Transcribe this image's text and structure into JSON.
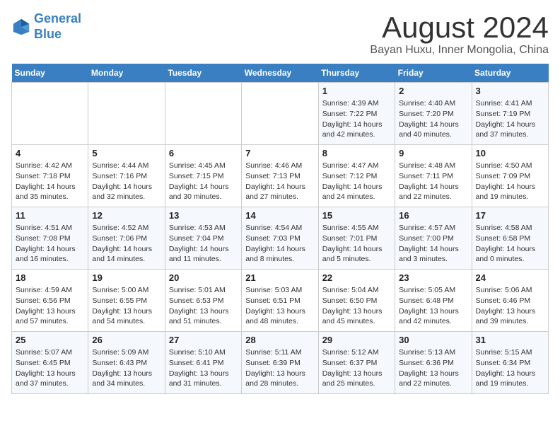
{
  "header": {
    "logo_line1": "General",
    "logo_line2": "Blue",
    "month_year": "August 2024",
    "location": "Bayan Huxu, Inner Mongolia, China"
  },
  "weekdays": [
    "Sunday",
    "Monday",
    "Tuesday",
    "Wednesday",
    "Thursday",
    "Friday",
    "Saturday"
  ],
  "weeks": [
    [
      {
        "day": "",
        "info": ""
      },
      {
        "day": "",
        "info": ""
      },
      {
        "day": "",
        "info": ""
      },
      {
        "day": "",
        "info": ""
      },
      {
        "day": "1",
        "info": "Sunrise: 4:39 AM\nSunset: 7:22 PM\nDaylight: 14 hours\nand 42 minutes."
      },
      {
        "day": "2",
        "info": "Sunrise: 4:40 AM\nSunset: 7:20 PM\nDaylight: 14 hours\nand 40 minutes."
      },
      {
        "day": "3",
        "info": "Sunrise: 4:41 AM\nSunset: 7:19 PM\nDaylight: 14 hours\nand 37 minutes."
      }
    ],
    [
      {
        "day": "4",
        "info": "Sunrise: 4:42 AM\nSunset: 7:18 PM\nDaylight: 14 hours\nand 35 minutes."
      },
      {
        "day": "5",
        "info": "Sunrise: 4:44 AM\nSunset: 7:16 PM\nDaylight: 14 hours\nand 32 minutes."
      },
      {
        "day": "6",
        "info": "Sunrise: 4:45 AM\nSunset: 7:15 PM\nDaylight: 14 hours\nand 30 minutes."
      },
      {
        "day": "7",
        "info": "Sunrise: 4:46 AM\nSunset: 7:13 PM\nDaylight: 14 hours\nand 27 minutes."
      },
      {
        "day": "8",
        "info": "Sunrise: 4:47 AM\nSunset: 7:12 PM\nDaylight: 14 hours\nand 24 minutes."
      },
      {
        "day": "9",
        "info": "Sunrise: 4:48 AM\nSunset: 7:11 PM\nDaylight: 14 hours\nand 22 minutes."
      },
      {
        "day": "10",
        "info": "Sunrise: 4:50 AM\nSunset: 7:09 PM\nDaylight: 14 hours\nand 19 minutes."
      }
    ],
    [
      {
        "day": "11",
        "info": "Sunrise: 4:51 AM\nSunset: 7:08 PM\nDaylight: 14 hours\nand 16 minutes."
      },
      {
        "day": "12",
        "info": "Sunrise: 4:52 AM\nSunset: 7:06 PM\nDaylight: 14 hours\nand 14 minutes."
      },
      {
        "day": "13",
        "info": "Sunrise: 4:53 AM\nSunset: 7:04 PM\nDaylight: 14 hours\nand 11 minutes."
      },
      {
        "day": "14",
        "info": "Sunrise: 4:54 AM\nSunset: 7:03 PM\nDaylight: 14 hours\nand 8 minutes."
      },
      {
        "day": "15",
        "info": "Sunrise: 4:55 AM\nSunset: 7:01 PM\nDaylight: 14 hours\nand 5 minutes."
      },
      {
        "day": "16",
        "info": "Sunrise: 4:57 AM\nSunset: 7:00 PM\nDaylight: 14 hours\nand 3 minutes."
      },
      {
        "day": "17",
        "info": "Sunrise: 4:58 AM\nSunset: 6:58 PM\nDaylight: 14 hours\nand 0 minutes."
      }
    ],
    [
      {
        "day": "18",
        "info": "Sunrise: 4:59 AM\nSunset: 6:56 PM\nDaylight: 13 hours\nand 57 minutes."
      },
      {
        "day": "19",
        "info": "Sunrise: 5:00 AM\nSunset: 6:55 PM\nDaylight: 13 hours\nand 54 minutes."
      },
      {
        "day": "20",
        "info": "Sunrise: 5:01 AM\nSunset: 6:53 PM\nDaylight: 13 hours\nand 51 minutes."
      },
      {
        "day": "21",
        "info": "Sunrise: 5:03 AM\nSunset: 6:51 PM\nDaylight: 13 hours\nand 48 minutes."
      },
      {
        "day": "22",
        "info": "Sunrise: 5:04 AM\nSunset: 6:50 PM\nDaylight: 13 hours\nand 45 minutes."
      },
      {
        "day": "23",
        "info": "Sunrise: 5:05 AM\nSunset: 6:48 PM\nDaylight: 13 hours\nand 42 minutes."
      },
      {
        "day": "24",
        "info": "Sunrise: 5:06 AM\nSunset: 6:46 PM\nDaylight: 13 hours\nand 39 minutes."
      }
    ],
    [
      {
        "day": "25",
        "info": "Sunrise: 5:07 AM\nSunset: 6:45 PM\nDaylight: 13 hours\nand 37 minutes."
      },
      {
        "day": "26",
        "info": "Sunrise: 5:09 AM\nSunset: 6:43 PM\nDaylight: 13 hours\nand 34 minutes."
      },
      {
        "day": "27",
        "info": "Sunrise: 5:10 AM\nSunset: 6:41 PM\nDaylight: 13 hours\nand 31 minutes."
      },
      {
        "day": "28",
        "info": "Sunrise: 5:11 AM\nSunset: 6:39 PM\nDaylight: 13 hours\nand 28 minutes."
      },
      {
        "day": "29",
        "info": "Sunrise: 5:12 AM\nSunset: 6:37 PM\nDaylight: 13 hours\nand 25 minutes."
      },
      {
        "day": "30",
        "info": "Sunrise: 5:13 AM\nSunset: 6:36 PM\nDaylight: 13 hours\nand 22 minutes."
      },
      {
        "day": "31",
        "info": "Sunrise: 5:15 AM\nSunset: 6:34 PM\nDaylight: 13 hours\nand 19 minutes."
      }
    ]
  ]
}
